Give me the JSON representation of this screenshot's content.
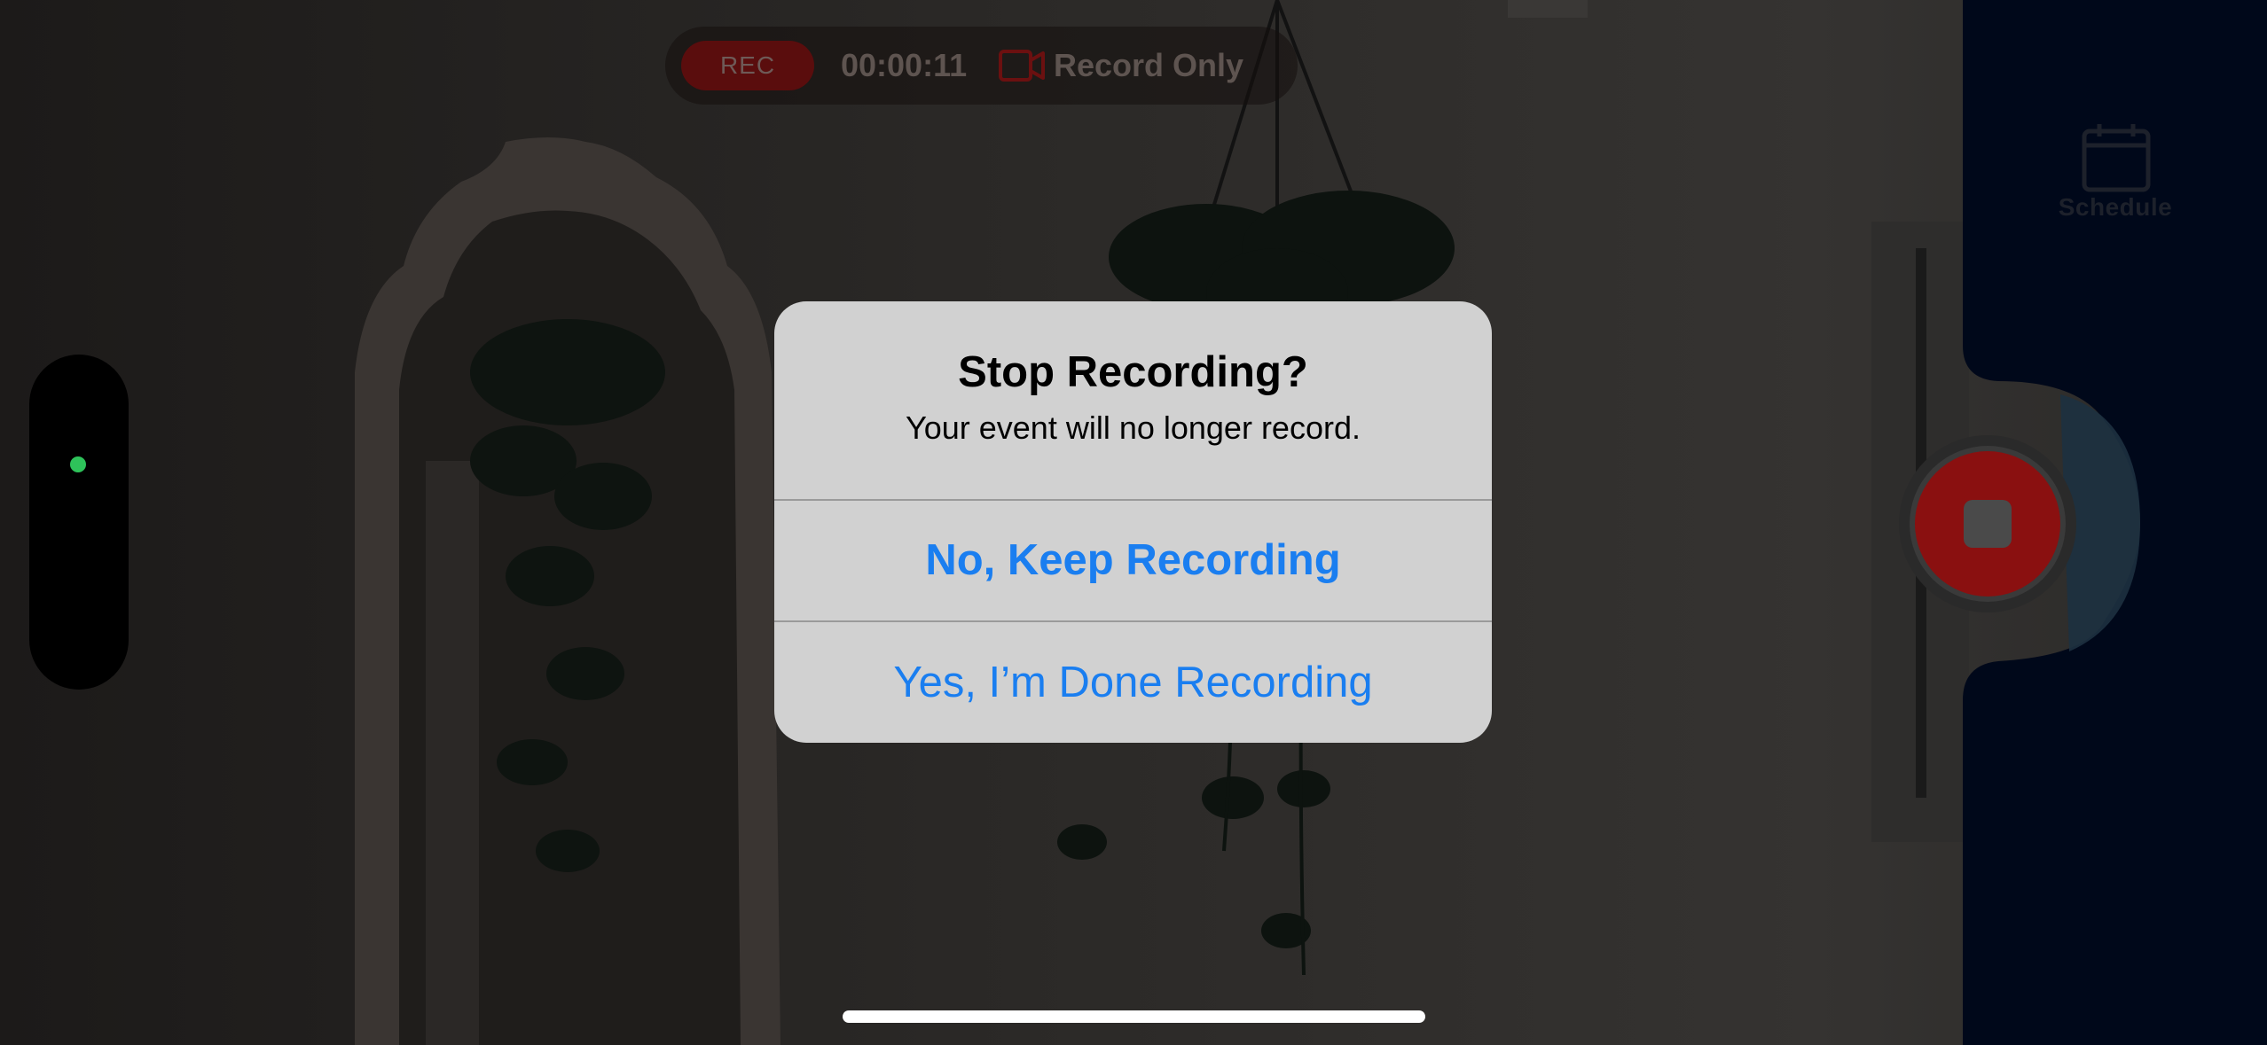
{
  "status_bar": {
    "rec_label": "REC",
    "timer": "00:00:11",
    "mode_icon": "video-camera-icon",
    "mode_label": "Record Only"
  },
  "side_panel": {
    "schedule_icon": "calendar-icon",
    "schedule_label": "Schedule",
    "stop_button_icon": "stop-square-icon"
  },
  "zoom_control": {
    "indicator_color": "#2ec25a"
  },
  "alert": {
    "title": "Stop Recording?",
    "message": "Your event will no longer record.",
    "actions": [
      {
        "label": "No, Keep Recording",
        "style": "bold"
      },
      {
        "label": "Yes, I’m Done Recording",
        "style": "regular"
      }
    ]
  },
  "colors": {
    "accent": "#1a7ef0",
    "record_red": "#8a1010",
    "panel_navy": "#00081a",
    "alert_bg": "#d1d1d1"
  }
}
